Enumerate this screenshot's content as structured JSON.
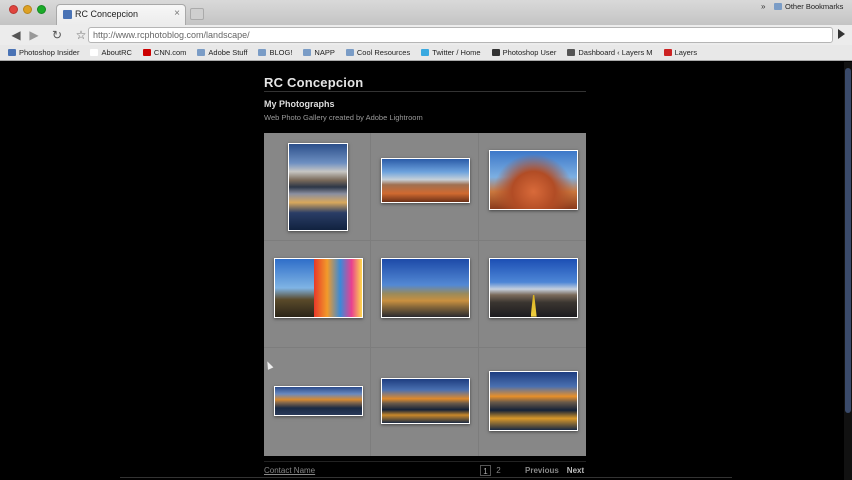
{
  "browser": {
    "tab_title": "RC Concepcion",
    "tab_close": "×",
    "url": "http://www.rcphotoblog.com/landscape/",
    "icons": [
      "back-arrow-icon",
      "forward-arrow-icon",
      "reload-icon",
      "star-icon",
      "go-arrow-icon"
    ]
  },
  "bookmarks": {
    "items": [
      {
        "label": "Photoshop Insider",
        "color": "#4a73b5"
      },
      {
        "label": "AboutRC",
        "color": "#ffffff"
      },
      {
        "label": "CNN.com",
        "color": "#cc0000"
      },
      {
        "label": "Adobe Stuff",
        "color": "#7a9cc6"
      },
      {
        "label": "BLOG!",
        "color": "#7a9cc6"
      },
      {
        "label": "NAPP",
        "color": "#7a9cc6"
      },
      {
        "label": "Cool Resources",
        "color": "#7a9cc6"
      },
      {
        "label": "Twitter / Home",
        "color": "#39a9e0"
      },
      {
        "label": "Photoshop User",
        "color": "#333333"
      },
      {
        "label": "Dashboard ‹ Layers M",
        "color": "#555555"
      },
      {
        "label": "Layers",
        "color": "#cc2222"
      }
    ],
    "overflow": "»",
    "other": "Other Bookmarks"
  },
  "page": {
    "site_title": "RC Concepcion",
    "gallery_title": "My Photographs",
    "gallery_description": "Web Photo Gallery created by Adobe Lightroom",
    "thumbnails": [
      "photo-thumb-1",
      "photo-thumb-2",
      "photo-thumb-3",
      "photo-thumb-4",
      "photo-thumb-5",
      "photo-thumb-6",
      "photo-thumb-7",
      "photo-thumb-8",
      "photo-thumb-9"
    ],
    "contact": "Contact Name",
    "pages": [
      "1",
      "2"
    ],
    "current_page": "1",
    "previous": "Previous",
    "next": "Next"
  }
}
